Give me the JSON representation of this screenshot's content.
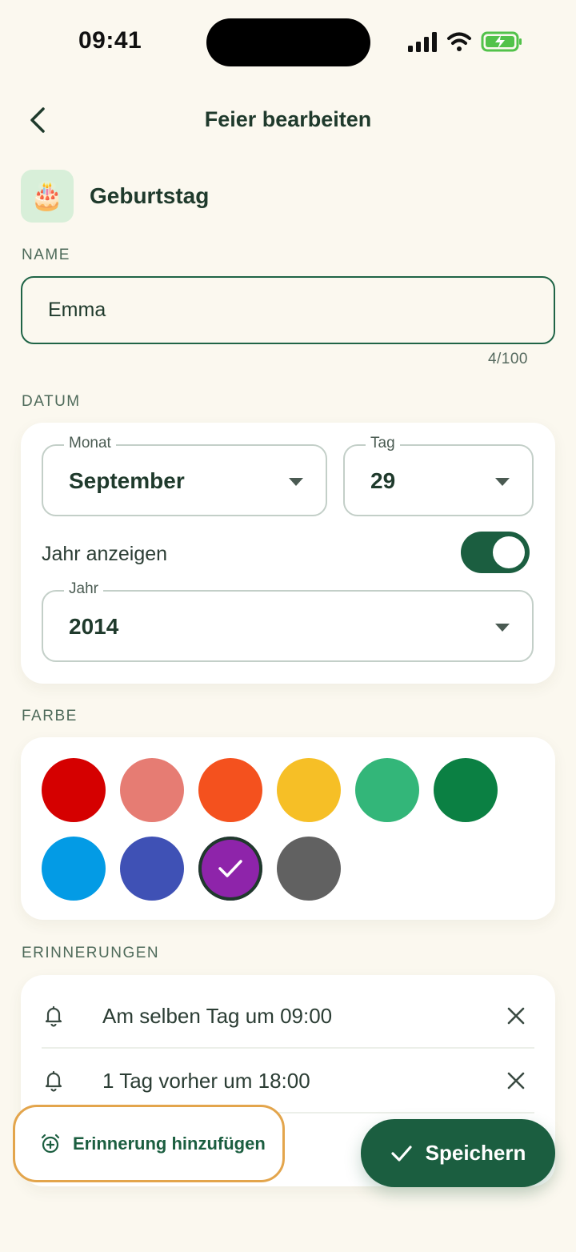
{
  "status_bar": {
    "time": "09:41"
  },
  "header": {
    "title": "Feier bearbeiten"
  },
  "category": {
    "icon": "🎂",
    "label": "Geburtstag"
  },
  "name_section": {
    "label": "NAME",
    "value": "Emma",
    "counter": "4/100"
  },
  "date_section": {
    "label": "DATUM",
    "month": {
      "legend": "Monat",
      "value": "September"
    },
    "day": {
      "legend": "Tag",
      "value": "29"
    },
    "show_year": {
      "label": "Jahr anzeigen",
      "enabled": true
    },
    "year": {
      "legend": "Jahr",
      "value": "2014"
    }
  },
  "color_section": {
    "label": "FARBE",
    "colors": [
      "#d50000",
      "#e67c73",
      "#f4511e",
      "#f6bf26",
      "#33b679",
      "#0b8043",
      "#039be5",
      "#3f51b5",
      "#8e24aa",
      "#616161"
    ],
    "selected_index": 8
  },
  "reminders_section": {
    "label": "ERINNERUNGEN",
    "items": [
      {
        "text": "Am selben Tag um 09:00"
      },
      {
        "text": "1 Tag vorher um 18:00"
      }
    ],
    "add_label": "Erinnerung hinzufügen"
  },
  "save_button": {
    "label": "Speichern"
  },
  "theme": {
    "primary": "#1b5e40",
    "background": "#fbf8ef",
    "highlight": "#e3a54c"
  }
}
